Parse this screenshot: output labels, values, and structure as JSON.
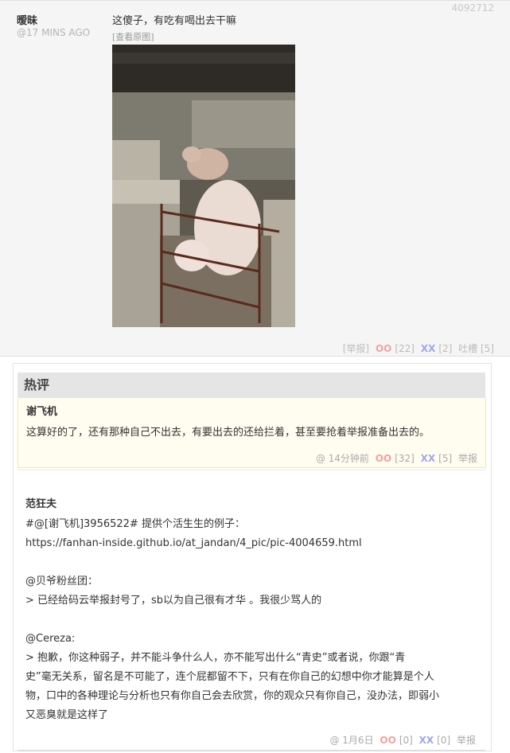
{
  "post": {
    "id": "4092712",
    "author": "暧昧",
    "time": "@17 MINS AGO",
    "content": "这傻子，有吃有喝出去干嘛",
    "view_original": "[查看原图]",
    "image_alt": "pigs in pen",
    "actions": {
      "report": "[举报]",
      "oo_label": "OO",
      "oo_count": "[22]",
      "xx_label": "XX",
      "xx_count": "[2]",
      "tucao": "吐槽 [5]"
    }
  },
  "hot": {
    "header": "热评",
    "comment": {
      "author": "谢飞机",
      "text": "这算好的了，还有那种自己不出去，有要出去的还给拦着，甚至要抢着举报准备出去的。",
      "time": "@ 14分钟前",
      "oo_label": "OO",
      "oo_count": "[32]",
      "xx_label": "XX",
      "xx_count": "[5]",
      "report": "举报"
    }
  },
  "comment": {
    "author": "范狂夫",
    "line1": "#@[谢飞机]3956522# 提供个活生生的例子：",
    "line2": "https://fanhan-inside.github.io/at_jandan/4_pic/pic-4004659.html",
    "line3": "@贝爷粉丝团：",
    "line4": "> 已经给码云举报封号了，sb以为自己很有才华 。我很少骂人的",
    "line5": "@Cereza:",
    "line6": "> 抱歉，你这种弱子，并不能斗争什么人，亦不能写出什么“青史”或者说，你跟“青",
    "line7": "史”毫无关系，留名是不可能了，连个屁都留不下，只有在你自己的幻想中你才能算是个人",
    "line8": "物，口中的各种理论与分析也只有你自己会去欣赏，你的观众只有你自己，没办法，即弱小",
    "line9": "又恶臭就是这样了",
    "time": "@ 1月6日",
    "oo_label": "OO",
    "oo_count": "[0]",
    "xx_label": "XX",
    "xx_count": "[0]",
    "report": "举报"
  },
  "colors": {
    "oo": "#f7a0a0",
    "xx": "#9ea6ee",
    "hot_bg": "#fffdf0",
    "header_bg": "#e5e5e5"
  }
}
